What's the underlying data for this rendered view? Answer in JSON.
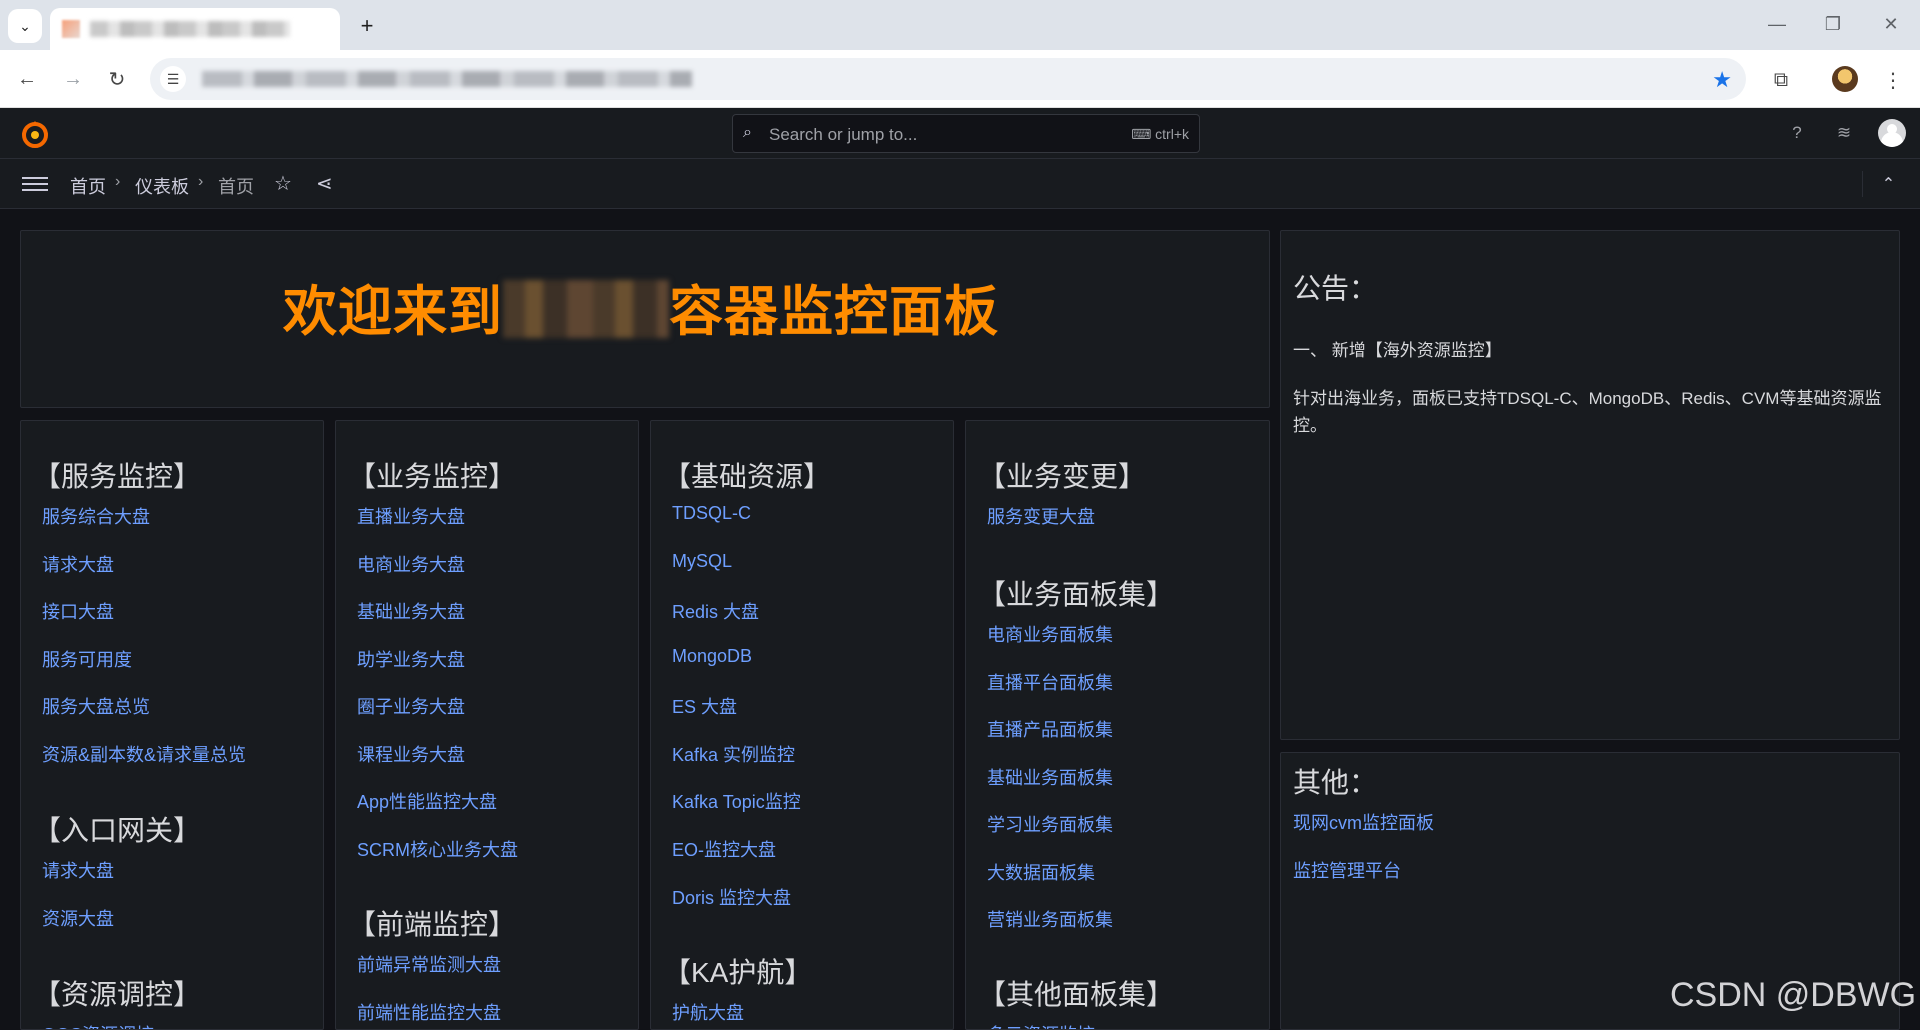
{
  "browser": {
    "new_tab": "+",
    "controls": {
      "minimize": "—",
      "restore": "❐",
      "close": "✕"
    }
  },
  "grafana": {
    "search_placeholder": "Search or jump to...",
    "search_shortcut": "⌨ ctrl+k",
    "breadcrumb": [
      "首页",
      "仪表板",
      "首页"
    ]
  },
  "welcome": {
    "prefix": "欢迎来到",
    "suffix": "容器监控面板"
  },
  "columns": [
    {
      "groups": [
        {
          "title": "【服务监控】",
          "links": [
            "服务综合大盘",
            "请求大盘",
            "接口大盘",
            "服务可用度",
            "服务大盘总览",
            "资源&副本数&请求量总览"
          ]
        },
        {
          "title": "【入口网关】",
          "links": [
            "请求大盘",
            "资源大盘"
          ]
        },
        {
          "title": "【资源调控】",
          "links": [
            "QOS资源调控"
          ]
        }
      ]
    },
    {
      "groups": [
        {
          "title": "【业务监控】",
          "links": [
            "直播业务大盘",
            "电商业务大盘",
            "基础业务大盘",
            "助学业务大盘",
            "圈子业务大盘",
            "课程业务大盘",
            "App性能监控大盘",
            "SCRM核心业务大盘"
          ]
        },
        {
          "title": "【前端监控】",
          "links": [
            "前端异常监测大盘",
            "前端性能监控大盘"
          ]
        }
      ]
    },
    {
      "groups": [
        {
          "title": "【基础资源】",
          "links": [
            "TDSQL-C",
            "MySQL",
            "Redis 大盘",
            "MongoDB",
            "ES 大盘",
            "Kafka 实例监控",
            "Kafka Topic监控",
            "EO-监控大盘",
            "Doris 监控大盘"
          ]
        },
        {
          "title": "【KA护航】",
          "links": [
            "护航大盘"
          ]
        }
      ]
    },
    {
      "groups": [
        {
          "title": "【业务变更】",
          "links": [
            "服务变更大盘"
          ]
        },
        {
          "title": "【业务面板集】",
          "links": [
            "电商业务面板集",
            "直播平台面板集",
            "直播产品面板集",
            "基础业务面板集",
            "学习业务面板集",
            "大数据面板集",
            "营销业务面板集"
          ]
        },
        {
          "title": "【其他面板集】",
          "links": [
            "多云资源监控"
          ]
        }
      ]
    }
  ],
  "notice": {
    "title": "公告：",
    "item": "一、 新增【海外资源监控】",
    "body": "针对出海业务，面板已支持TDSQL-C、MongoDB、Redis、CVM等基础资源监控。"
  },
  "other": {
    "title": "其他：",
    "links": [
      "现网cvm监控面板",
      "监控管理平台"
    ]
  },
  "watermark": "CSDN @DBWG",
  "colors": {
    "accent_orange": "#ff8c00",
    "link_blue": "#6e9fff",
    "bg": "#111217",
    "panel": "#181b1f"
  }
}
